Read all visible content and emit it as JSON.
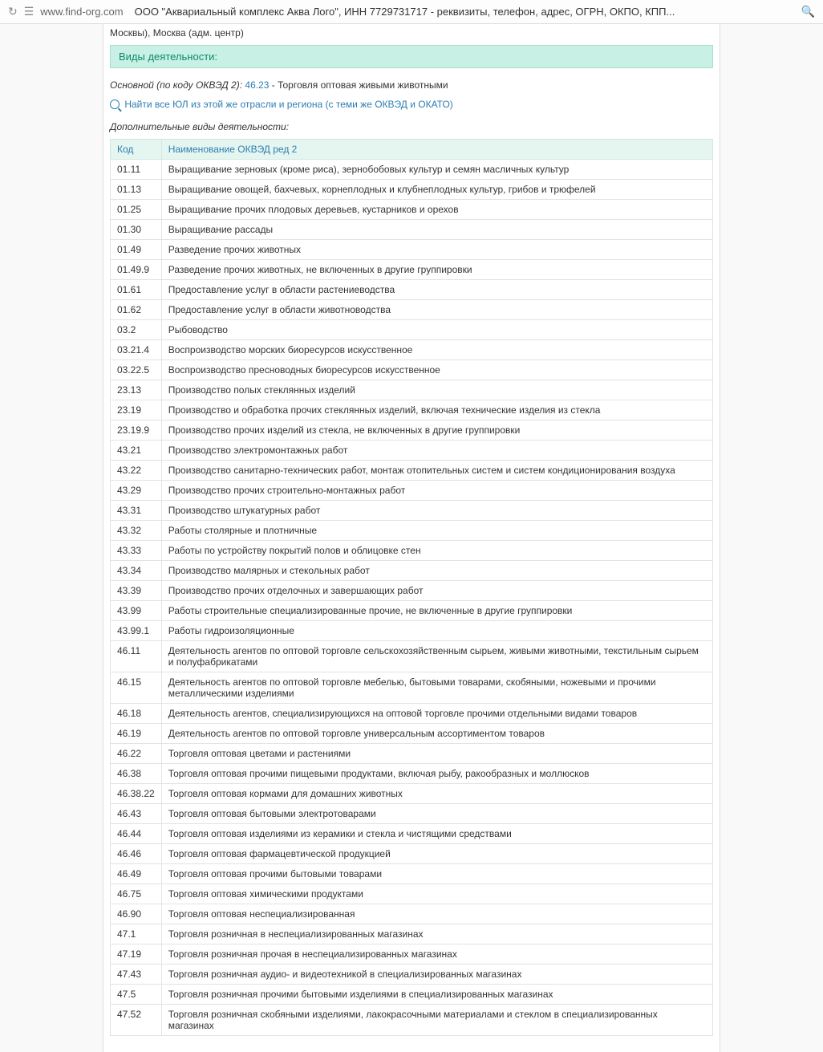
{
  "browser": {
    "url": "www.find-org.com",
    "title": "ООО \"Аквариальный комплекс Аква Лого\", ИНН 7729731717 - реквизиты, телефон, адрес, ОГРН, ОКПО, КПП..."
  },
  "region_line": "Москвы), Москва (адм. центр)",
  "section_header": "Виды деятельности:",
  "main_activity": {
    "label": "Основной (по коду ОКВЭД 2):",
    "code": "46.23",
    "desc": "- Торговля оптовая живыми животными"
  },
  "find_link": "Найти все ЮЛ из этой же отрасли и региона (с теми же ОКВЭД и ОКАТО)",
  "extra_label": "Дополнительные виды деятельности:",
  "table": {
    "head_code": "Код",
    "head_name": "Наименование ОКВЭД ред 2",
    "rows": [
      {
        "code": "01.11",
        "name": "Выращивание зерновых (кроме риса), зернобобовых культур и семян масличных культур"
      },
      {
        "code": "01.13",
        "name": "Выращивание овощей, бахчевых, корнеплодных и клубнеплодных культур, грибов и трюфелей"
      },
      {
        "code": "01.25",
        "name": "Выращивание прочих плодовых деревьев, кустарников и орехов"
      },
      {
        "code": "01.30",
        "name": "Выращивание рассады"
      },
      {
        "code": "01.49",
        "name": "Разведение прочих животных"
      },
      {
        "code": "01.49.9",
        "name": "Разведение прочих животных, не включенных в другие группировки"
      },
      {
        "code": "01.61",
        "name": "Предоставление услуг в области растениеводства"
      },
      {
        "code": "01.62",
        "name": "Предоставление услуг в области животноводства"
      },
      {
        "code": "03.2",
        "name": "Рыбоводство"
      },
      {
        "code": "03.21.4",
        "name": "Воспроизводство морских биоресурсов искусственное"
      },
      {
        "code": "03.22.5",
        "name": "Воспроизводство пресноводных биоресурсов искусственное"
      },
      {
        "code": "23.13",
        "name": "Производство полых стеклянных изделий"
      },
      {
        "code": "23.19",
        "name": "Производство и обработка прочих стеклянных изделий, включая технические изделия из стекла"
      },
      {
        "code": "23.19.9",
        "name": "Производство прочих изделий из стекла, не включенных в другие группировки"
      },
      {
        "code": "43.21",
        "name": "Производство электромонтажных работ"
      },
      {
        "code": "43.22",
        "name": "Производство санитарно-технических работ, монтаж отопительных систем и систем кондиционирования воздуха"
      },
      {
        "code": "43.29",
        "name": "Производство прочих строительно-монтажных работ"
      },
      {
        "code": "43.31",
        "name": "Производство штукатурных работ"
      },
      {
        "code": "43.32",
        "name": "Работы столярные и плотничные"
      },
      {
        "code": "43.33",
        "name": "Работы по устройству покрытий полов и облицовке стен"
      },
      {
        "code": "43.34",
        "name": "Производство малярных и стекольных работ"
      },
      {
        "code": "43.39",
        "name": "Производство прочих отделочных и завершающих работ"
      },
      {
        "code": "43.99",
        "name": "Работы строительные специализированные прочие, не включенные в другие группировки"
      },
      {
        "code": "43.99.1",
        "name": "Работы гидроизоляционные"
      },
      {
        "code": "46.11",
        "name": "Деятельность агентов по оптовой торговле сельскохозяйственным сырьем, живыми животными, текстильным сырьем и полуфабрикатами"
      },
      {
        "code": "46.15",
        "name": "Деятельность агентов по оптовой торговле мебелью, бытовыми товарами, скобяными, ножевыми и прочими металлическими изделиями"
      },
      {
        "code": "46.18",
        "name": "Деятельность агентов, специализирующихся на оптовой торговле прочими отдельными видами товаров"
      },
      {
        "code": "46.19",
        "name": "Деятельность агентов по оптовой торговле универсальным ассортиментом товаров"
      },
      {
        "code": "46.22",
        "name": "Торговля оптовая цветами и растениями"
      },
      {
        "code": "46.38",
        "name": "Торговля оптовая прочими пищевыми продуктами, включая рыбу, ракообразных и моллюсков"
      },
      {
        "code": "46.38.22",
        "name": "Торговля оптовая кормами для домашних животных"
      },
      {
        "code": "46.43",
        "name": "Торговля оптовая бытовыми электротоварами"
      },
      {
        "code": "46.44",
        "name": "Торговля оптовая изделиями из керамики и стекла и чистящими средствами"
      },
      {
        "code": "46.46",
        "name": "Торговля оптовая фармацевтической продукцией"
      },
      {
        "code": "46.49",
        "name": "Торговля оптовая прочими бытовыми товарами"
      },
      {
        "code": "46.75",
        "name": "Торговля оптовая химическими продуктами"
      },
      {
        "code": "46.90",
        "name": "Торговля оптовая неспециализированная"
      },
      {
        "code": "47.1",
        "name": "Торговля розничная в неспециализированных магазинах"
      },
      {
        "code": "47.19",
        "name": "Торговля розничная прочая в неспециализированных магазинах"
      },
      {
        "code": "47.43",
        "name": "Торговля розничная аудио- и видеотехникой в специализированных магазинах"
      },
      {
        "code": "47.5",
        "name": "Торговля розничная прочими бытовыми изделиями в специализированных магазинах"
      },
      {
        "code": "47.52",
        "name": "Торговля розничная скобяными изделиями, лакокрасочными материалами и стеклом в специализированных магазинах"
      }
    ]
  }
}
